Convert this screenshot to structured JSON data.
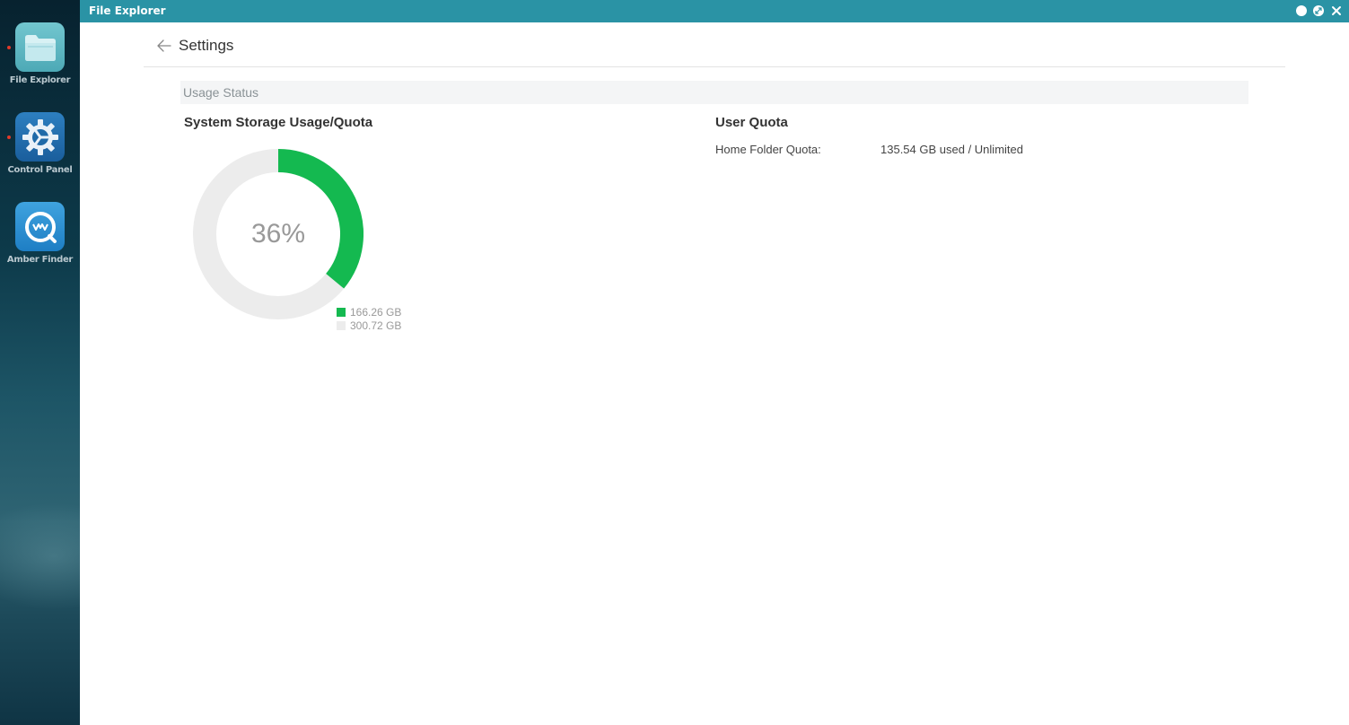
{
  "desktop": {
    "apps": [
      {
        "label": "File Explorer",
        "icon": "folder-icon",
        "running": true
      },
      {
        "label": "Control Panel",
        "icon": "gear-icon",
        "running": true
      },
      {
        "label": "Amber Finder",
        "icon": "amber-finder-icon",
        "running": false
      }
    ]
  },
  "window": {
    "title": "File Explorer",
    "controls": [
      "minimize-icon",
      "restore-icon",
      "close-icon"
    ]
  },
  "header": {
    "title": "Settings",
    "back_icon": "arrow-left-icon"
  },
  "usage": {
    "section_title": "Usage Status",
    "storage": {
      "title": "System Storage Usage/Quota",
      "percent_label": "36%",
      "used_label": "166.26 GB",
      "free_label": "300.72 GB",
      "used_fraction": 0.36,
      "colors": {
        "used": "#14b950",
        "free": "#ececec"
      }
    },
    "quota": {
      "title": "User Quota",
      "label": "Home Folder Quota:",
      "value": "135.54 GB used / Unlimited"
    }
  },
  "colors": {
    "titlebar": "#2a93a5",
    "accent_green": "#14b950"
  }
}
